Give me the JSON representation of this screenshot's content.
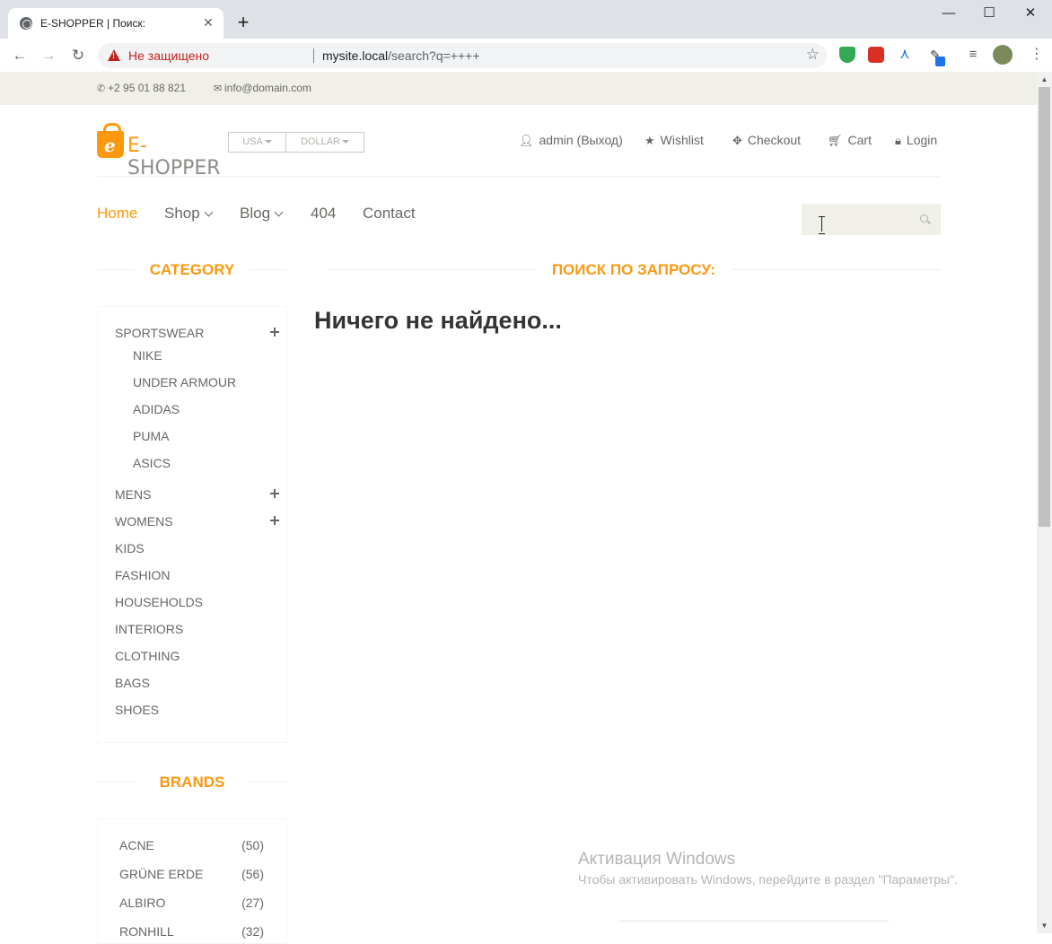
{
  "browser": {
    "tab_title": "E-SHOPPER | Поиск:",
    "insecure_label": "Не защищено",
    "url_host": "mysite.local",
    "url_path": "/search?q=++++"
  },
  "topbar": {
    "phone": "+2 95 01 88 821",
    "email": "info@domain.com"
  },
  "logo": {
    "prefix": "E-",
    "name": "SHOPPER"
  },
  "dropdowns": {
    "country": "USA",
    "currency": "DOLLAR"
  },
  "user_nav": {
    "account": "admin (Выход)",
    "wishlist": "Wishlist",
    "checkout": "Checkout",
    "cart": "Cart",
    "login": "Login"
  },
  "main_nav": {
    "home": "Home",
    "shop": "Shop",
    "blog": "Blog",
    "not_found": "404",
    "contact": "Contact"
  },
  "search": {
    "placeholder": ""
  },
  "sidebar": {
    "category_title": "Category",
    "categories": [
      {
        "label": "Sportswear",
        "expandable": true
      },
      {
        "label": "Mens",
        "expandable": true
      },
      {
        "label": "Womens",
        "expandable": true
      },
      {
        "label": "Kids"
      },
      {
        "label": "Fashion"
      },
      {
        "label": "Households"
      },
      {
        "label": "Interiors"
      },
      {
        "label": "Clothing"
      },
      {
        "label": "Bags"
      },
      {
        "label": "Shoes"
      }
    ],
    "sportswear_sub": [
      "Nike",
      "Under Armour",
      "Adidas",
      "Puma",
      "ASICS"
    ],
    "brands_title": "Brands",
    "brands": [
      {
        "name": "Acne",
        "count": "(50)"
      },
      {
        "name": "Grüne Erde",
        "count": "(56)"
      },
      {
        "name": "Albiro",
        "count": "(27)"
      },
      {
        "name": "Ronhill",
        "count": "(32)"
      }
    ]
  },
  "content": {
    "section_title": "Поиск по запросу:",
    "message": "Ничего не найдено..."
  },
  "watermark": {
    "title": "Активация Windows",
    "subtitle": "Чтобы активировать Windows, перейдите в раздел \"Параметры\"."
  },
  "colors": {
    "accent": "#fe980f",
    "topbar_bg": "#f0f0e9",
    "text": "#696763"
  }
}
